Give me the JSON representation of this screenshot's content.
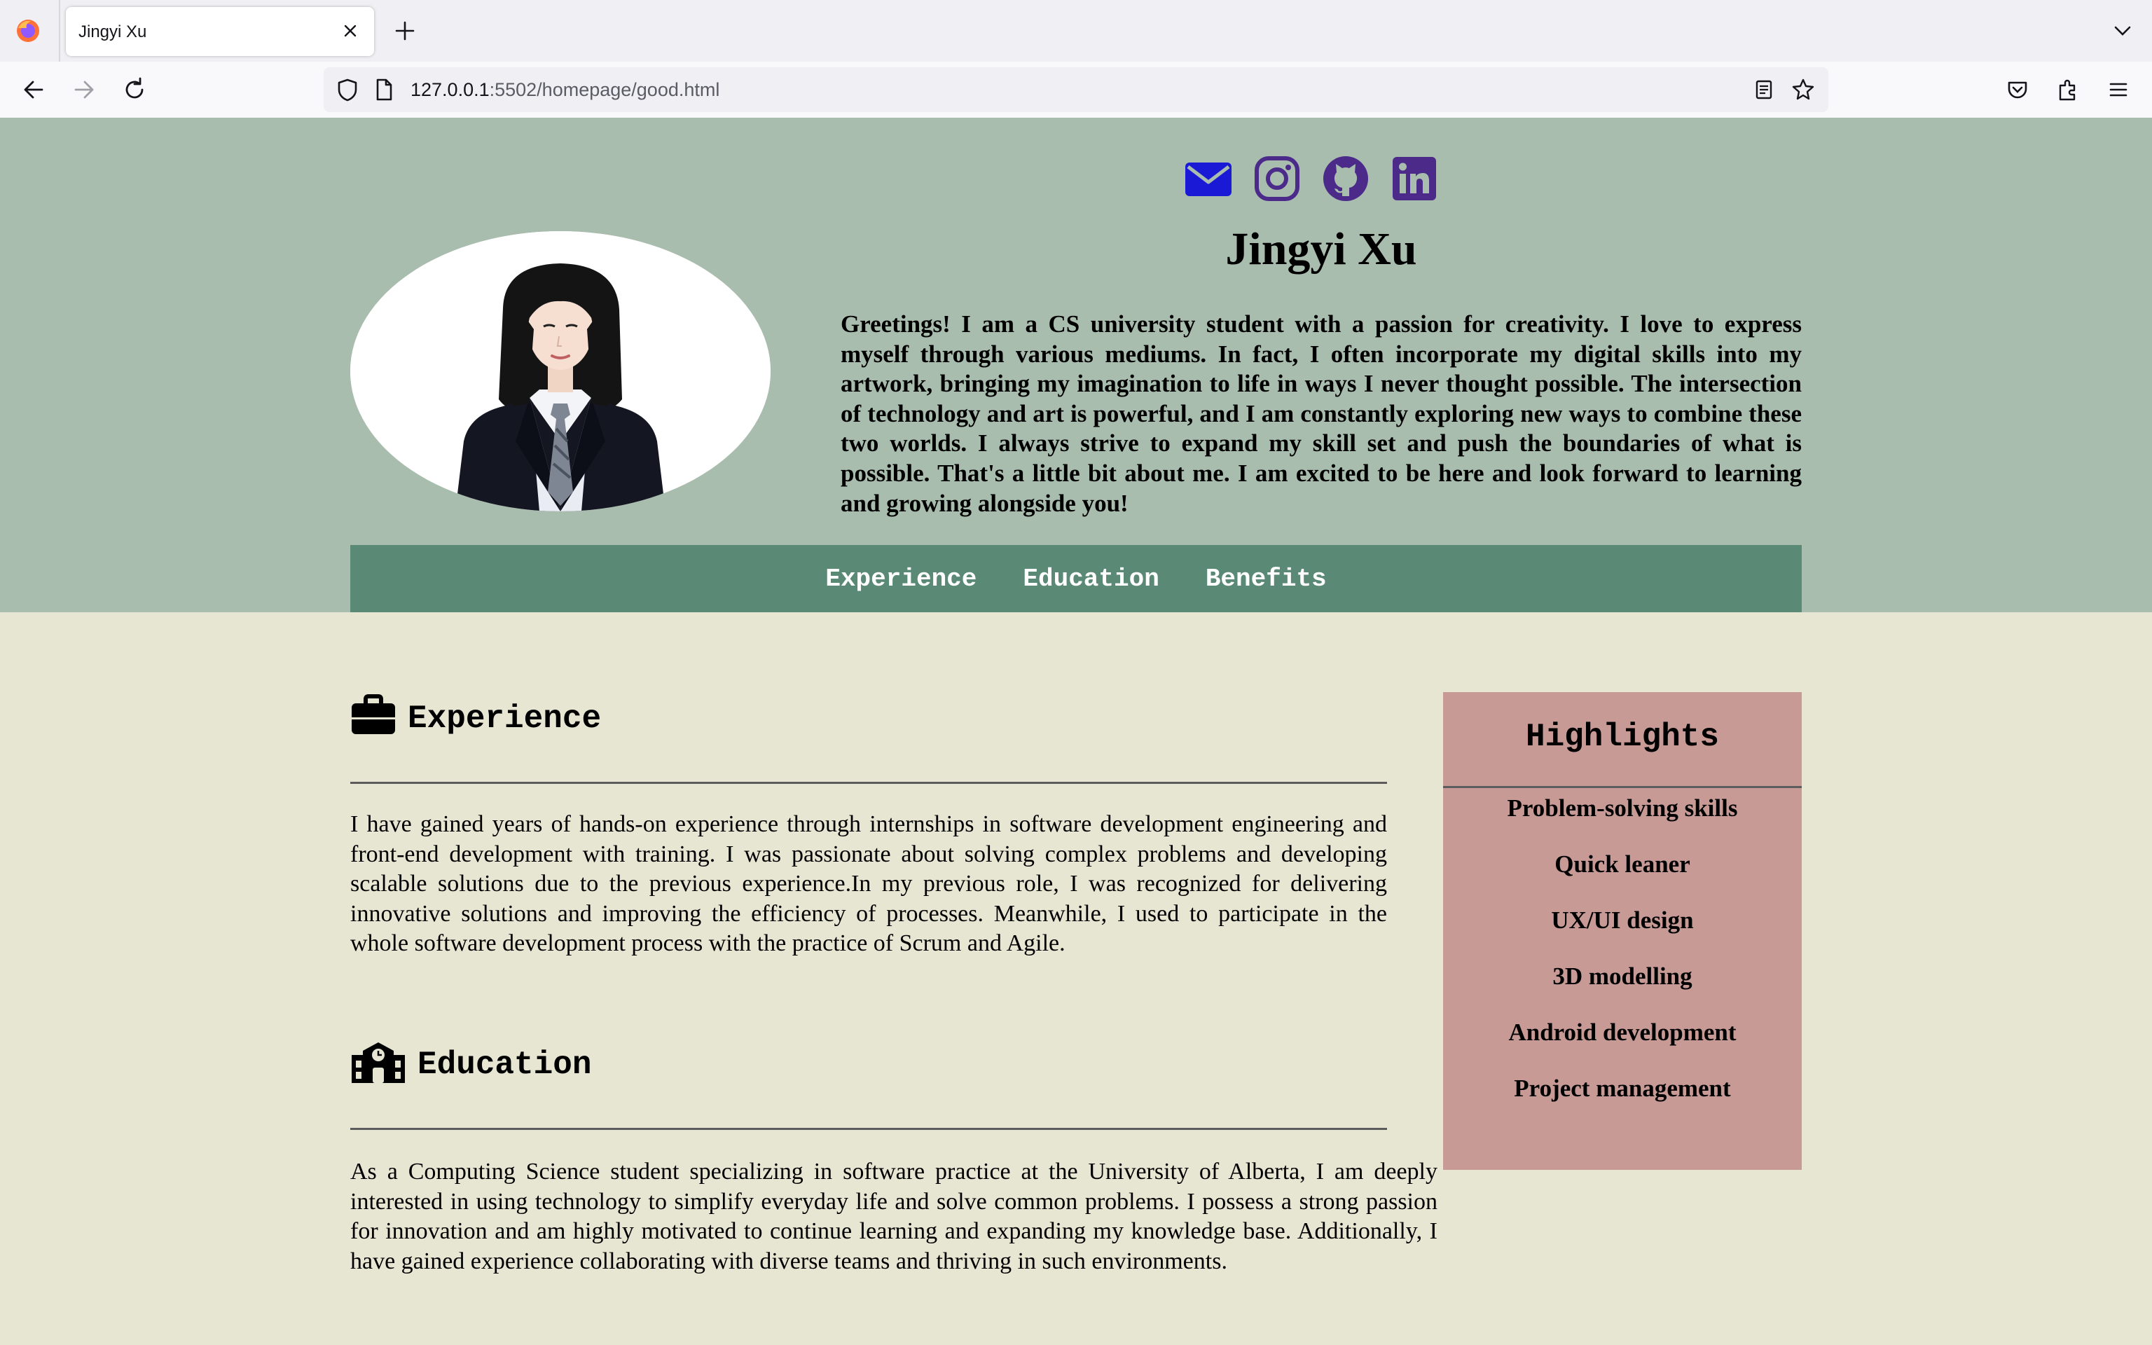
{
  "browser": {
    "tab_title": "Jingyi Xu",
    "url_host": "127.0.0.1",
    "url_rest": ":5502/homepage/good.html"
  },
  "socials": [
    {
      "icon": "envelope-icon",
      "color": "#1a1ad6"
    },
    {
      "icon": "instagram-icon",
      "color": "#4b2a8a"
    },
    {
      "icon": "github-icon",
      "color": "#4b2a8a"
    },
    {
      "icon": "linkedin-icon",
      "color": "#4b2a8a"
    }
  ],
  "profile": {
    "name": "Jingyi Xu",
    "intro": "Greetings! I am a CS university student with a passion for creativity. I love to express myself through various mediums. In fact, I often incorporate my digital skills into my artwork, bringing my imagination to life in ways I never thought possible. The intersection of technology and art is powerful, and I am constantly exploring new ways to combine these two worlds. I always strive to expand my skill set and push the boundaries of what is possible. That's a little bit about me. I am excited to be here and look forward to learning and growing alongside you!"
  },
  "menu": {
    "items": [
      "Experience",
      "Education",
      "Benefits"
    ]
  },
  "experience": {
    "title": "Experience",
    "text": "I have gained years of hands-on experience through internships in software development engineering and front-end development with training. I was passionate about solving complex problems and developing scalable solutions due to the previous experience.In my previous role, I was recognized for delivering innovative solutions and improving the efficiency of processes. Meanwhile, I used to participate in the whole software development process with the practice of Scrum and Agile."
  },
  "education": {
    "title": "Education",
    "text": "As a Computing Science student specializing in software practice at the University of Alberta, I am deeply interested in using technology to simplify everyday life and solve common problems. I possess a strong passion for innovation and am highly motivated to continue learning and expanding my knowledge base. Additionally, I have gained experience collaborating with diverse teams and thriving in such environments."
  },
  "highlights": {
    "title": "Highlights",
    "items": [
      "Problem-solving skills",
      "Quick leaner",
      "UX/UI design",
      "3D modelling",
      "Android development",
      "Project management"
    ]
  },
  "colors": {
    "header_bg": "#a9bdaf",
    "menu_bg": "#5a8a76",
    "page_bg": "#e7e6d3",
    "highlights_bg": "#c89a96"
  }
}
